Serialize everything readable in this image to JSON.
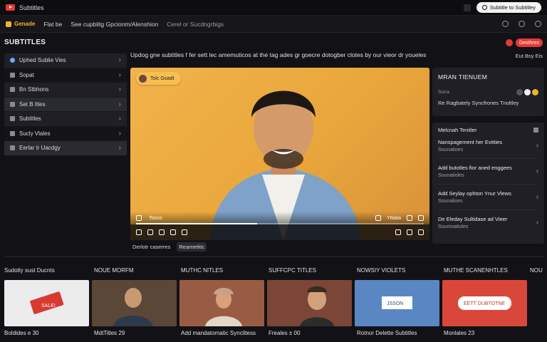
{
  "app": {
    "title": "Subtitles",
    "top_button": "Subtitle to Subtitley"
  },
  "nav": {
    "brand": "Genade",
    "links": [
      "Flat be",
      "See cupblitg Gpcionm/Alenshion",
      "Cerel or Sucdngrbigs"
    ]
  },
  "sidebar": {
    "title": "SUBTITLES",
    "items": [
      {
        "label": "Uphed Sublie Vies",
        "icon": "circle-icon"
      },
      {
        "label": "Sopat",
        "icon": "square-icon"
      },
      {
        "label": "Bn Stbhons",
        "icon": "square-icon"
      },
      {
        "label": "Set B Itles",
        "icon": "square-icon"
      },
      {
        "label": "Subtitles",
        "icon": "square-icon"
      },
      {
        "label": "Sucly Vlales",
        "icon": "square-icon"
      },
      {
        "label": "Eerlar Ir Uacdgy",
        "icon": "square-icon"
      }
    ]
  },
  "main": {
    "title": "Updog gne subtitles f fer sett lec amemuticos at the tag ades gr goecre dotogber clotes by our vieor dr youeles",
    "action_label": "Desthres",
    "settings_label": "Eut Bsy Eis"
  },
  "player": {
    "chip": "Tolc Goadt",
    "time": "Tooco",
    "right_label": "Ytlaba",
    "progress": 0.42,
    "tags": [
      "Derlotr caserres",
      "Rearnetitic"
    ]
  },
  "right_panel": {
    "top": {
      "title": "MRAN TIENUEM",
      "row_label": "Sorra",
      "foot": "Re Ragbately Syncfrones Tnoltley"
    },
    "list_head": "Melcnah Tenitler",
    "items": [
      {
        "title": "Nanspagement her Evitties",
        "subtitle": "Sounatioes"
      },
      {
        "title": "Add butotles fior aned enggees",
        "subtitle": "Sounatioles"
      },
      {
        "title": "Add Seylay ophton Ynur Vlews",
        "subtitle": "Sounalioes"
      },
      {
        "title": "De Eleday Sultidase ad Vieer",
        "subtitle": "Soumoatioles"
      }
    ]
  },
  "rail": {
    "labels": [
      "Sudotly sust Ducnts",
      "NOUE MORFM",
      "MUTHC NITLES",
      "SUFFCPC TITLES",
      "NOWSIY VIOLETS",
      "MUTHE SCANENHTLES",
      "NOUT"
    ],
    "thumbs": [
      {
        "kind": "ticket",
        "text": "SALE!"
      },
      {
        "kind": "person-glasses"
      },
      {
        "kind": "person-hat"
      },
      {
        "kind": "person-brick"
      },
      {
        "kind": "blue-card",
        "text": "JSSON"
      },
      {
        "kind": "red-card",
        "text": "EETT DUBTOTNE"
      }
    ],
    "captions": [
      "Boldides e 30",
      "MdtTitles 29",
      "Add mandatomatic Synclitess",
      "Freales ± 00",
      "Rotnor Delette Subtitles",
      "Monlales 23"
    ]
  },
  "colors": {
    "accent": "#f0b429",
    "danger": "#e53935",
    "player_bg": "#eba942"
  }
}
